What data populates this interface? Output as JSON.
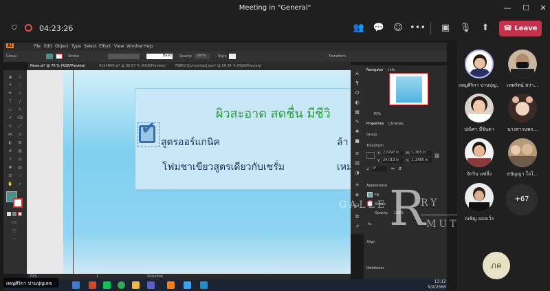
{
  "window": {
    "title": "Meeting in \"General\""
  },
  "meeting": {
    "timer": "04:23:26",
    "leave_label": "Leave",
    "more_participants": "+67",
    "self_initials": "ภค"
  },
  "participants": [
    {
      "name": "เพญศิริกา ปานปุญ..."
    },
    {
      "name": "เทพรัตน์ สว่า..."
    },
    {
      "name": "ปณิศา มีจินดา"
    },
    {
      "name": "นางสาวนพร..."
    },
    {
      "name": "จักริน แซ่ลิ้ง"
    },
    {
      "name": "ธนัญญา ใจโ..."
    },
    {
      "name": "ณชิญ ออลเวิ่ง"
    }
  ],
  "presenter_label": "เพญศิริกา ปานปุญเลข",
  "illustrator": {
    "menu": [
      "File",
      "Edit",
      "Object",
      "Type",
      "Select",
      "Effect",
      "View",
      "Window",
      "Help"
    ],
    "control": {
      "group": "Group",
      "stroke": "Stroke",
      "basic": "Basic",
      "opacity": "Opacity",
      "opacity_value": "100%",
      "style": "Style",
      "transform": "Transform"
    },
    "tabs": [
      "News.ai* @ 70 % (RGB/Preview)",
      "4124804.ai* @ 66.67 % (RGB/Preview)",
      "76869 [Converted].eps* @ 66.34 % (RGB/Preview)"
    ],
    "artwork": {
      "headline": "ผิวสะอาด สดชื่น มีชีวิ",
      "feature1": "สูตรออร์แกนิค",
      "feature1_right": "ล้า",
      "feature2": "โฟมชาเขียวสูตรเดียวกับเซรั่ม",
      "feature2_right": "เหม"
    },
    "status": {
      "zoom": "70%",
      "page": "1",
      "mode": "Selection"
    },
    "panel": {
      "navigator": "Navigator",
      "info": "Info",
      "zoom": "70%",
      "properties": "Properties",
      "libraries": "Libraries",
      "group": "Group",
      "transform": "Transform",
      "x_label": "X:",
      "x": "2.0797 in",
      "y_label": "Y:",
      "y": "24.013 in",
      "w_label": "W:",
      "w": "1.363 in",
      "h_label": "H:",
      "h": "1.2465 in",
      "angle": "0°",
      "appearance": "Appearance",
      "fill": "Fill",
      "stroke": "Stroke",
      "opacity": "Opacity",
      "opacity_value": "100%",
      "fx": "fx.",
      "align": "Align",
      "pathfinder": "Pathfinder"
    },
    "clock": {
      "time": "13:12",
      "date": "5/2/2565"
    }
  },
  "watermark": {
    "left": "GALLE",
    "big": "R",
    "right": "RY",
    "bottom": "MUTT"
  }
}
